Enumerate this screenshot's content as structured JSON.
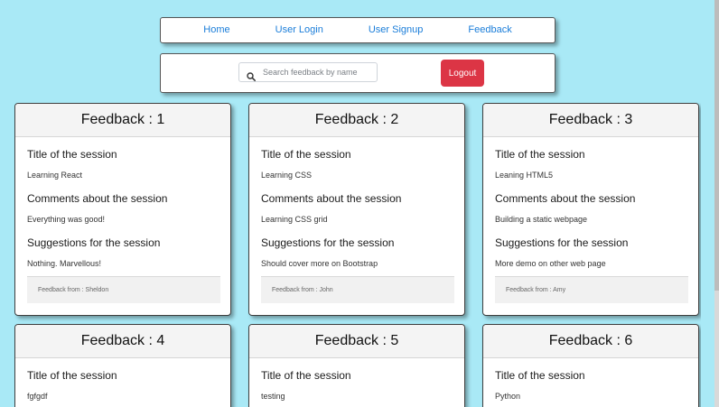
{
  "nav": {
    "links": [
      "Home",
      "User Login",
      "User Signup",
      "Feedback"
    ]
  },
  "actions": {
    "search_placeholder": "Search feedback by name",
    "logout_label": "Logout"
  },
  "cards": [
    {
      "title": "Feedback : 1",
      "session_title_label": "Title of the session",
      "session_title_value": "Learning React",
      "comments_label": "Comments about the session",
      "comments_value": "Everything was good!",
      "suggestions_label": "Suggestions for the session",
      "suggestions_value": "Nothing. Marvellous!",
      "footer": "Feedback from : Sheldon"
    },
    {
      "title": "Feedback : 2",
      "session_title_label": "Title of the session",
      "session_title_value": "Learning CSS",
      "comments_label": "Comments about the session",
      "comments_value": "Learning CSS grid",
      "suggestions_label": "Suggestions for the session",
      "suggestions_value": "Should cover more on Bootstrap",
      "footer": "Feedback from : John"
    },
    {
      "title": "Feedback : 3",
      "session_title_label": "Title of the session",
      "session_title_value": "Leaning HTML5",
      "comments_label": "Comments about the session",
      "comments_value": "Building a static webpage",
      "suggestions_label": "Suggestions for the session",
      "suggestions_value": "More demo on other web page",
      "footer": "Feedback from : Amy"
    },
    {
      "title": "Feedback : 4",
      "session_title_label": "Title of the session",
      "session_title_value": "fgfgdf"
    },
    {
      "title": "Feedback : 5",
      "session_title_label": "Title of the session",
      "session_title_value": "testing"
    },
    {
      "title": "Feedback : 6",
      "session_title_label": "Title of the session",
      "session_title_value": "Python"
    }
  ],
  "colors": {
    "page_background": "#a9e9f6",
    "nav_link": "#1a7dd9",
    "logout_background": "#dc3545"
  },
  "icons": {
    "search": "search-icon"
  }
}
